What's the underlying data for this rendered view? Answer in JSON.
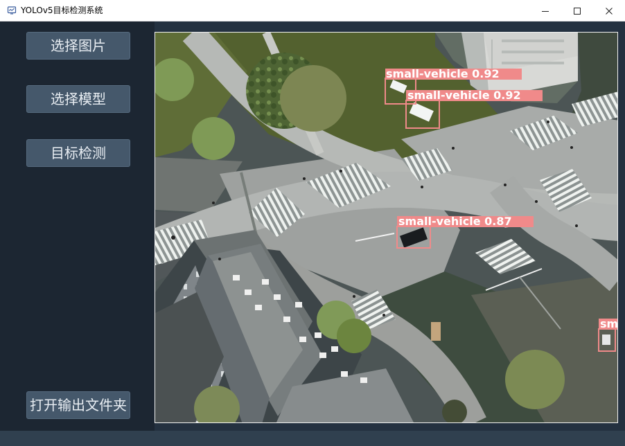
{
  "window": {
    "title": "YOLOv5目标检测系统"
  },
  "controls": {
    "select_image": "选择图片",
    "select_model": "选择模型",
    "detect": "目标检测",
    "open_output": "打开输出文件夹"
  },
  "detections": [
    {
      "label": "small-vehicle 0.92"
    },
    {
      "label": "small-vehicle 0.92"
    },
    {
      "label": "small-vehicle 0.87"
    },
    {
      "label": "sm"
    }
  ],
  "colors": {
    "background": "#243140",
    "button": "#45586b",
    "detection_box": "#f08a8a"
  },
  "icons": {
    "app": "app-window-icon",
    "minimize": "minimize-icon",
    "maximize": "maximize-icon",
    "close": "close-icon"
  }
}
